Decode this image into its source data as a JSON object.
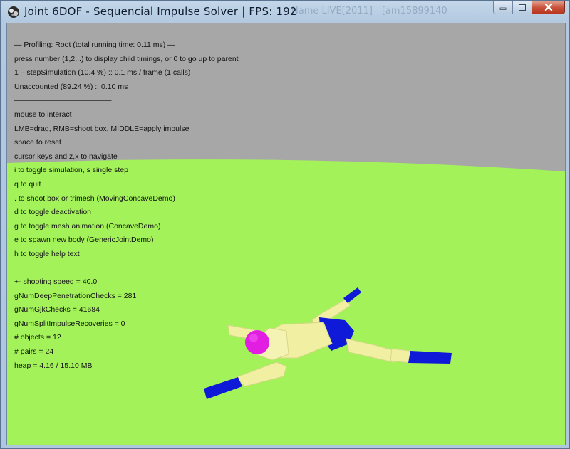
{
  "window": {
    "title": "Joint 6DOF - Sequencial Impulse Solver | FPS: 192",
    "background_title_fragment": "Name LIVE[2011] - [am15899140",
    "app_icon": "bullet-physics-icon",
    "controls": [
      "minimize-icon",
      "maximize-icon",
      "close-icon"
    ]
  },
  "colors": {
    "sky": "#a7a7a7",
    "ground": "#a3f25a",
    "limb_yellow": "#f1f0a2",
    "limb_blue": "#0f19d8",
    "head_magenta": "#e21ee2",
    "close_button": "#c8513a"
  },
  "hud": {
    "profiling": [
      "— Profiling: Root (total running time: 0.11 ms) —",
      "press number (1,2...) to display child timings, or 0 to go up to parent",
      "1 – stepSimulation (10.4 %) :: 0.1 ms / frame (1 calls)",
      "Unaccounted (89.24 %) :: 0.10 ms",
      "—————————————"
    ],
    "help": [
      "mouse to interact",
      "LMB=drag, RMB=shoot box, MIDDLE=apply impulse",
      "space to reset",
      "cursor keys and z,x to navigate",
      "i to toggle simulation, s single step",
      "q to quit",
      ". to shoot box or trimesh (MovingConcaveDemo)",
      "d to toggle deactivation",
      "g to toggle mesh animation (ConcaveDemo)",
      "e to spawn new body (GenericJointDemo)",
      "h to toggle help text",
      ""
    ],
    "stats": [
      "+- shooting speed = 40.0",
      "gNumDeepPenetrationChecks = 281",
      "gNumGjkChecks = 41684",
      "gNumSplitImpulseRecoveries = 0",
      "# objects = 12",
      "# pairs = 24",
      "heap = 4.16 / 15.10 MB"
    ]
  }
}
